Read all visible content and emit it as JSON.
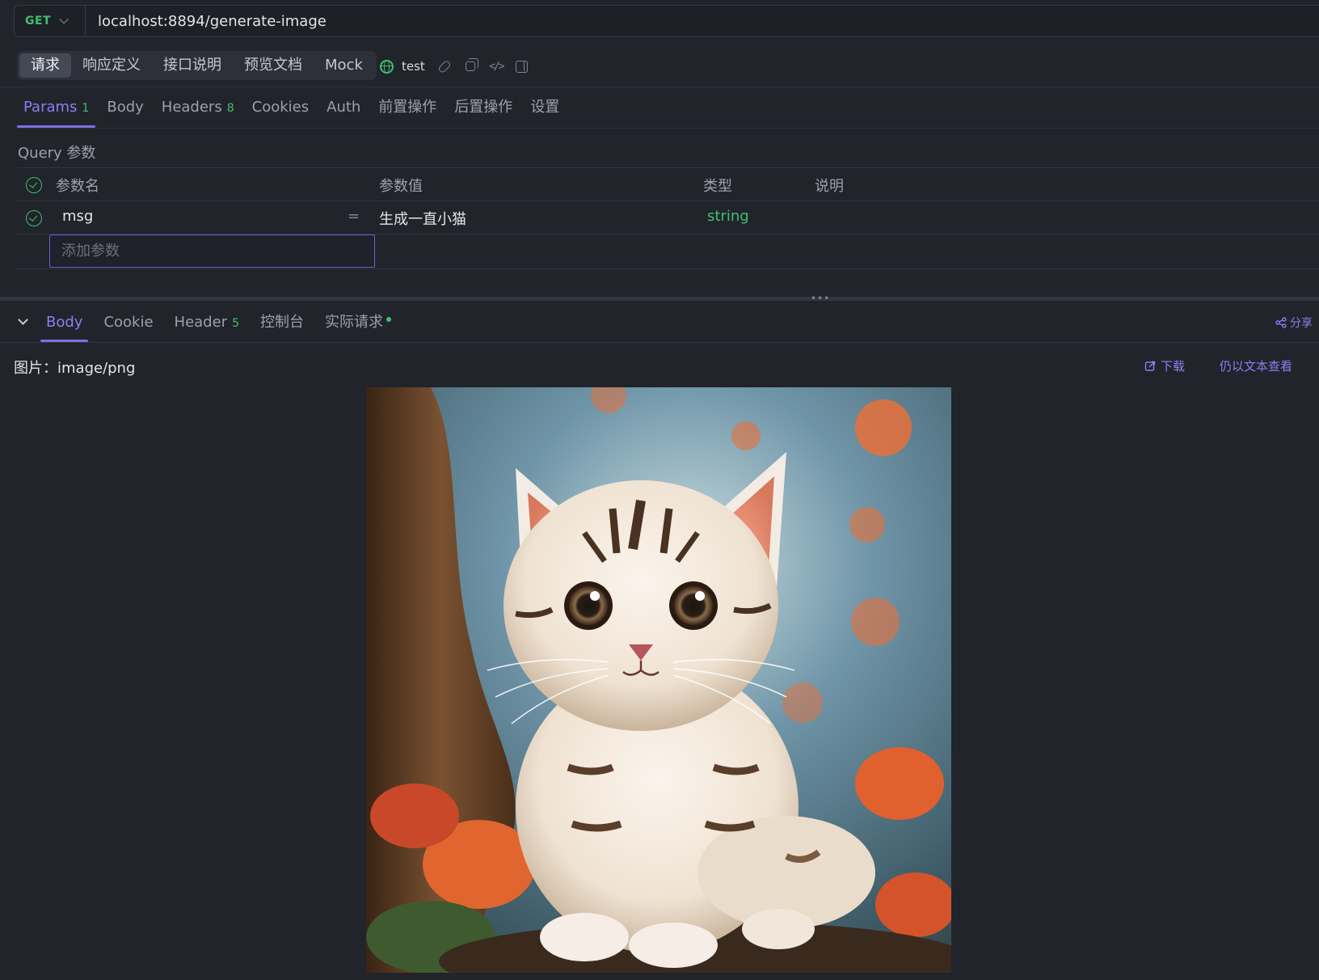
{
  "request": {
    "method": "GET",
    "url": "localhost:8894/generate-image"
  },
  "top_tabs": [
    "请求",
    "响应定义",
    "接口说明",
    "预览文档",
    "Mock"
  ],
  "environment": "test",
  "param_tabs": [
    {
      "label": "Params",
      "count": "1"
    },
    {
      "label": "Body",
      "count": ""
    },
    {
      "label": "Headers",
      "count": "8"
    },
    {
      "label": "Cookies",
      "count": ""
    },
    {
      "label": "Auth",
      "count": ""
    },
    {
      "label": "前置操作",
      "count": ""
    },
    {
      "label": "后置操作",
      "count": ""
    },
    {
      "label": "设置",
      "count": ""
    }
  ],
  "query": {
    "title": "Query 参数",
    "headers": {
      "name": "参数名",
      "value": "参数值",
      "type": "类型",
      "desc": "说明"
    },
    "rows": [
      {
        "name": "msg",
        "eq": "=",
        "value": "生成一直小猫",
        "type": "string"
      }
    ],
    "add_placeholder": "添加参数"
  },
  "response_tabs": [
    {
      "label": "Body",
      "count": ""
    },
    {
      "label": "Cookie",
      "count": ""
    },
    {
      "label": "Header",
      "count": "5"
    },
    {
      "label": "控制台",
      "count": ""
    },
    {
      "label": "实际请求",
      "count": ""
    }
  ],
  "share_label": "分享",
  "response": {
    "content_type": "图片：image/png",
    "download_label": "下载",
    "as_text_label": "仍以文本查看"
  },
  "colors": {
    "accent": "#8d7ff0",
    "success": "#3fbf6f",
    "background": "#21242b"
  },
  "icons": [
    "chevron-down-icon",
    "globe-icon",
    "link-icon",
    "copy-icon",
    "code-icon",
    "panel-icon",
    "check-circle-icon",
    "share-icon",
    "download-icon"
  ]
}
